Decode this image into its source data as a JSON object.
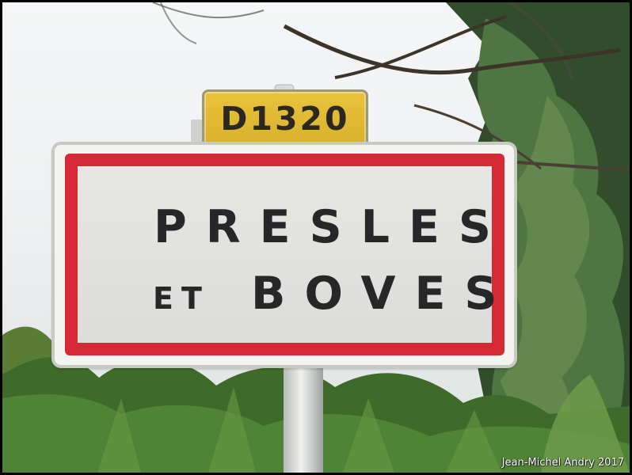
{
  "route_sign": {
    "text": "D1320",
    "color": "#e0bb34"
  },
  "town_sign": {
    "line1": "PRESLES",
    "line2_small": "ET",
    "line2_large": "BOVES",
    "border_color": "#d52a35",
    "background_color": "#e3e3df"
  },
  "credit": {
    "text": "Jean-Michel Andry 2017"
  },
  "scene": {
    "subject": "road-sign-photo",
    "icons": [
      "tree-canopy-icon",
      "grass-icon",
      "pole-icon"
    ]
  }
}
